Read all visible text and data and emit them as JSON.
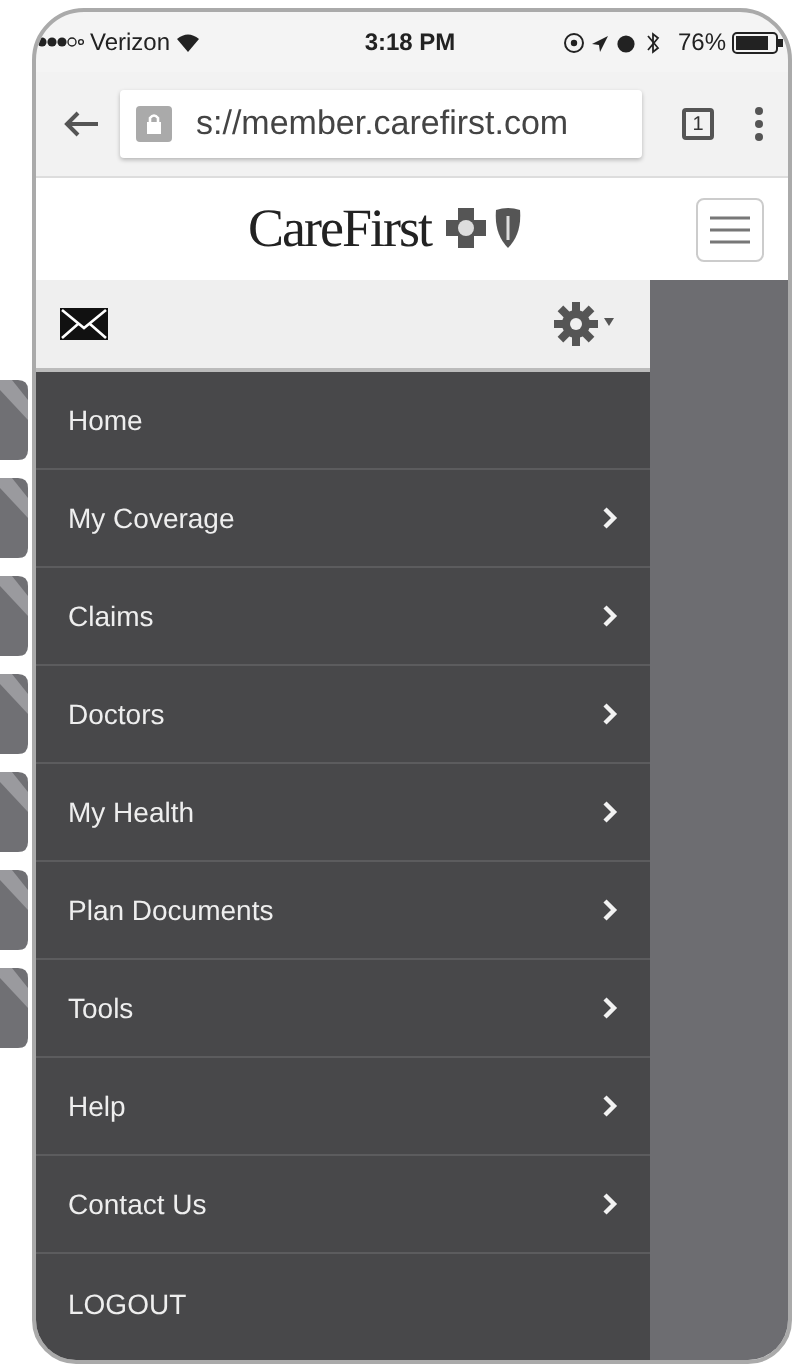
{
  "status_bar": {
    "carrier": "Verizon",
    "time": "3:18 PM",
    "battery": "76%"
  },
  "browser": {
    "url": "s://member.carefirst.com",
    "tab_count": "1"
  },
  "header": {
    "logo": "CareFirst"
  },
  "menu": {
    "items": [
      {
        "label": "Home",
        "expandable": false
      },
      {
        "label": "My Coverage",
        "expandable": true
      },
      {
        "label": "Claims",
        "expandable": true
      },
      {
        "label": "Doctors",
        "expandable": true
      },
      {
        "label": "My Health",
        "expandable": true
      },
      {
        "label": "Plan Documents",
        "expandable": true
      },
      {
        "label": "Tools",
        "expandable": true
      },
      {
        "label": "Help",
        "expandable": true
      },
      {
        "label": "Contact Us",
        "expandable": true
      },
      {
        "label": "LOGOUT",
        "expandable": false
      }
    ]
  }
}
